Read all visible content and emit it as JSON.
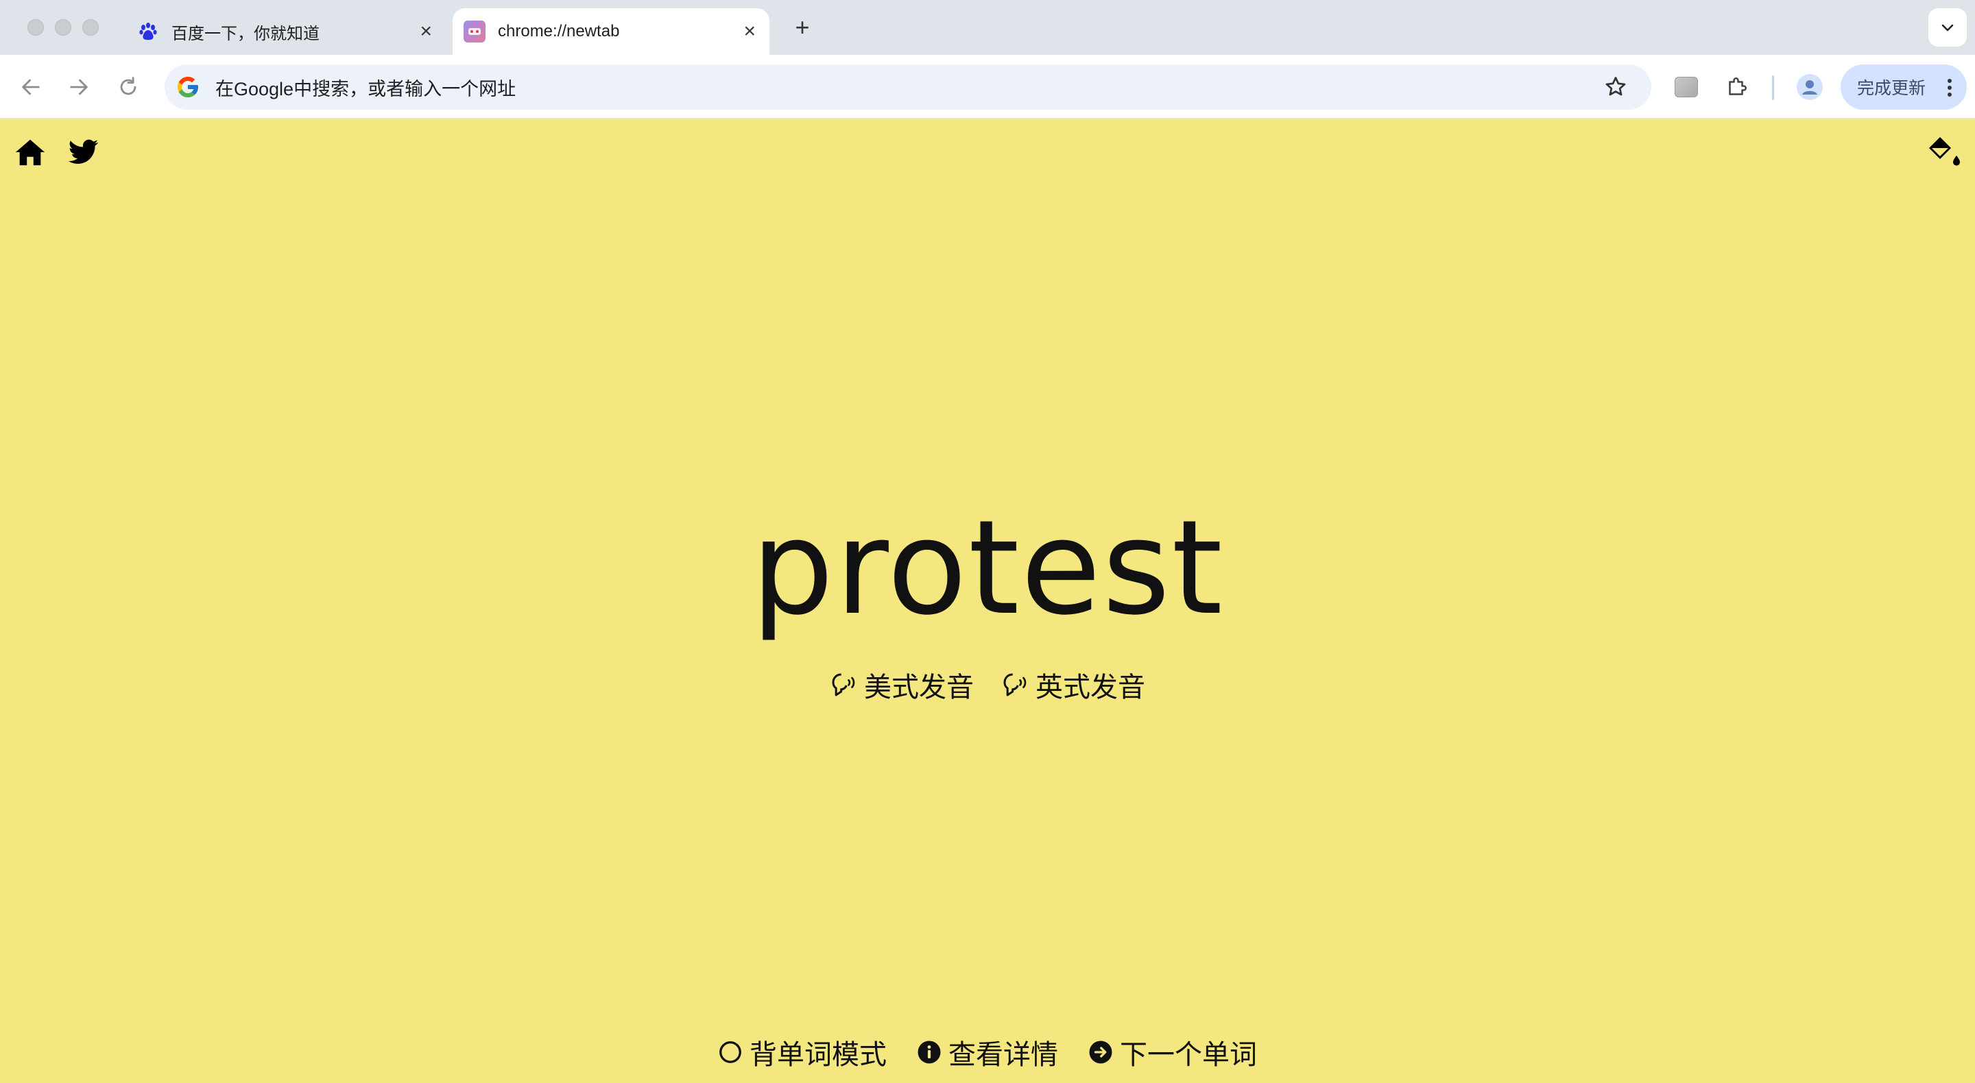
{
  "browser": {
    "tabs": [
      {
        "title": "百度一下，你就知道",
        "active": false,
        "favicon": "baidu-paw-icon"
      },
      {
        "title": "chrome://newtab",
        "active": true,
        "favicon": "extension-favicon"
      }
    ],
    "omnibox": {
      "placeholder": "在Google中搜索，或者输入一个网址"
    },
    "update_button": "完成更新"
  },
  "page": {
    "word": "protest",
    "pronunciations": [
      {
        "label": "美式发音",
        "icon": "speak-icon"
      },
      {
        "label": "英式发音",
        "icon": "speak-icon"
      }
    ],
    "actions": [
      {
        "label": "背单词模式",
        "icon": "circle-outline-icon"
      },
      {
        "label": "查看详情",
        "icon": "info-icon"
      },
      {
        "label": "下一个单词",
        "icon": "arrow-right-circle-icon"
      }
    ],
    "colors": {
      "background": "#f5e77f",
      "text": "#111111"
    }
  }
}
